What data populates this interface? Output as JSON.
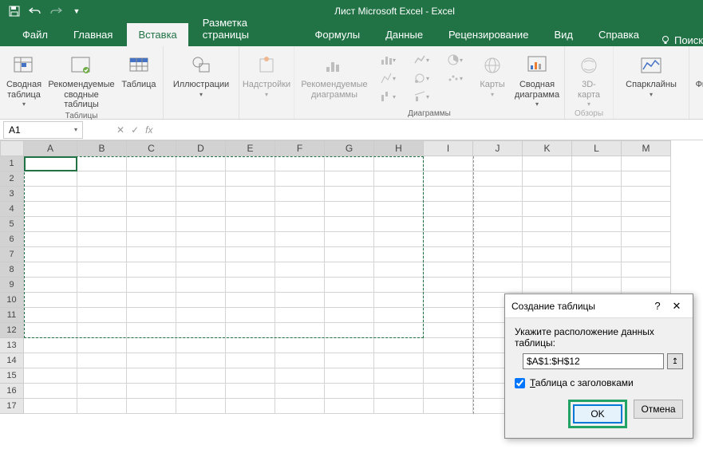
{
  "title": "Лист Microsoft Excel  -  Excel",
  "tabs": {
    "file": "Файл",
    "home": "Главная",
    "insert": "Вставка",
    "layout": "Разметка страницы",
    "formulas": "Формулы",
    "data": "Данные",
    "review": "Рецензирование",
    "view": "Вид",
    "help": "Справка",
    "tellme": "Поиск"
  },
  "ribbon": {
    "tables_group": "Таблицы",
    "pivot": "Сводная\nтаблица",
    "rec_pivot": "Рекомендуемые\nсводные таблицы",
    "table": "Таблица",
    "illustrations": "Иллюстрации",
    "addins": "Надстройки",
    "rec_charts": "Рекомендуемые\nдиаграммы",
    "charts_group": "Диаграммы",
    "maps": "Карты",
    "pivot_chart": "Сводная\nдиаграмма",
    "tours_group": "Обзоры",
    "map3d": "3D-\nкарта",
    "sparklines": "Спарклайны",
    "filters": "Фильтры"
  },
  "formula_bar": {
    "name": "A1",
    "fx": "fx"
  },
  "columns": [
    "A",
    "B",
    "C",
    "D",
    "E",
    "F",
    "G",
    "H",
    "I",
    "J",
    "K",
    "L",
    "M"
  ],
  "rows": [
    1,
    2,
    3,
    4,
    5,
    6,
    7,
    8,
    9,
    10,
    11,
    12,
    13,
    14,
    15,
    16,
    17
  ],
  "dialog": {
    "title": "Создание таблицы",
    "prompt": "Укажите расположение данных таблицы:",
    "range": "$A$1:$H$12",
    "headers": "Таблица с заголовками",
    "ok": "OK",
    "cancel": "Отмена"
  },
  "selection": {
    "cols": 8,
    "rows": 12
  }
}
